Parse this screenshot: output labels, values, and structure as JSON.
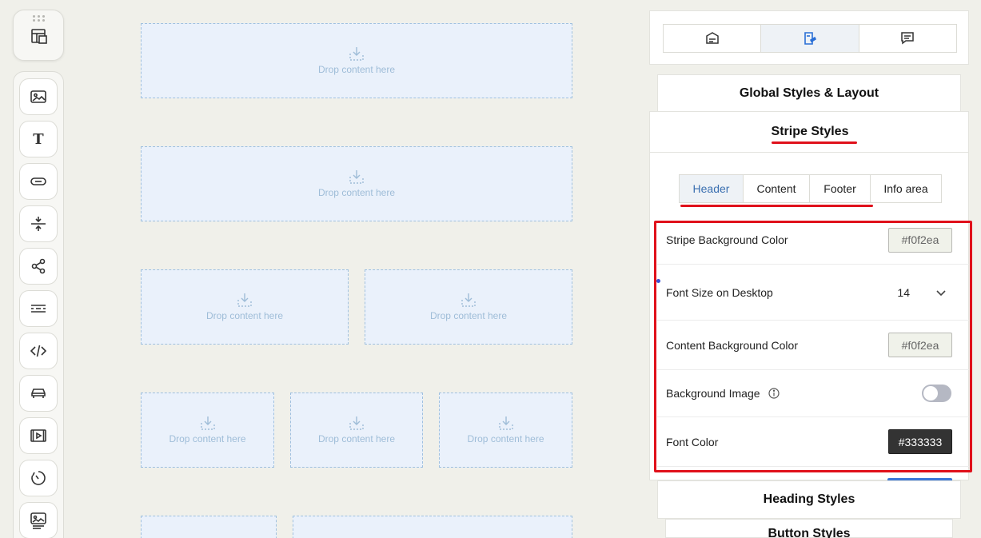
{
  "canvas": {
    "drop_text": "Drop content here"
  },
  "right_panel": {
    "tabs": [
      {
        "icon": "page-settings-icon"
      },
      {
        "icon": "style-paint-icon",
        "active": true
      },
      {
        "icon": "comment-icon"
      }
    ],
    "global_styles_label": "Global Styles & Layout",
    "stripe_styles_label": "Stripe Styles",
    "subtabs": [
      "Header",
      "Content",
      "Footer",
      "Info area"
    ],
    "active_subtab": "Header",
    "settings": {
      "stripe_bg": {
        "label": "Stripe Background Color",
        "value": "#f0f2ea"
      },
      "font_size": {
        "label": "Font Size on Desktop",
        "value": "14"
      },
      "content_bg": {
        "label": "Content Background Color",
        "value": "#f0f2ea"
      },
      "bg_image": {
        "label": "Background Image",
        "enabled": false
      },
      "font_color": {
        "label": "Font Color",
        "value": "#333333"
      }
    },
    "heading_styles_label": "Heading Styles",
    "button_styles_label": "Button Styles"
  },
  "colors": {
    "accent_red": "#e0111b",
    "active_tab_text": "#3a6fb0",
    "drop_bg": "#eaf1fb",
    "canvas_bg": "#f0f0ea"
  }
}
